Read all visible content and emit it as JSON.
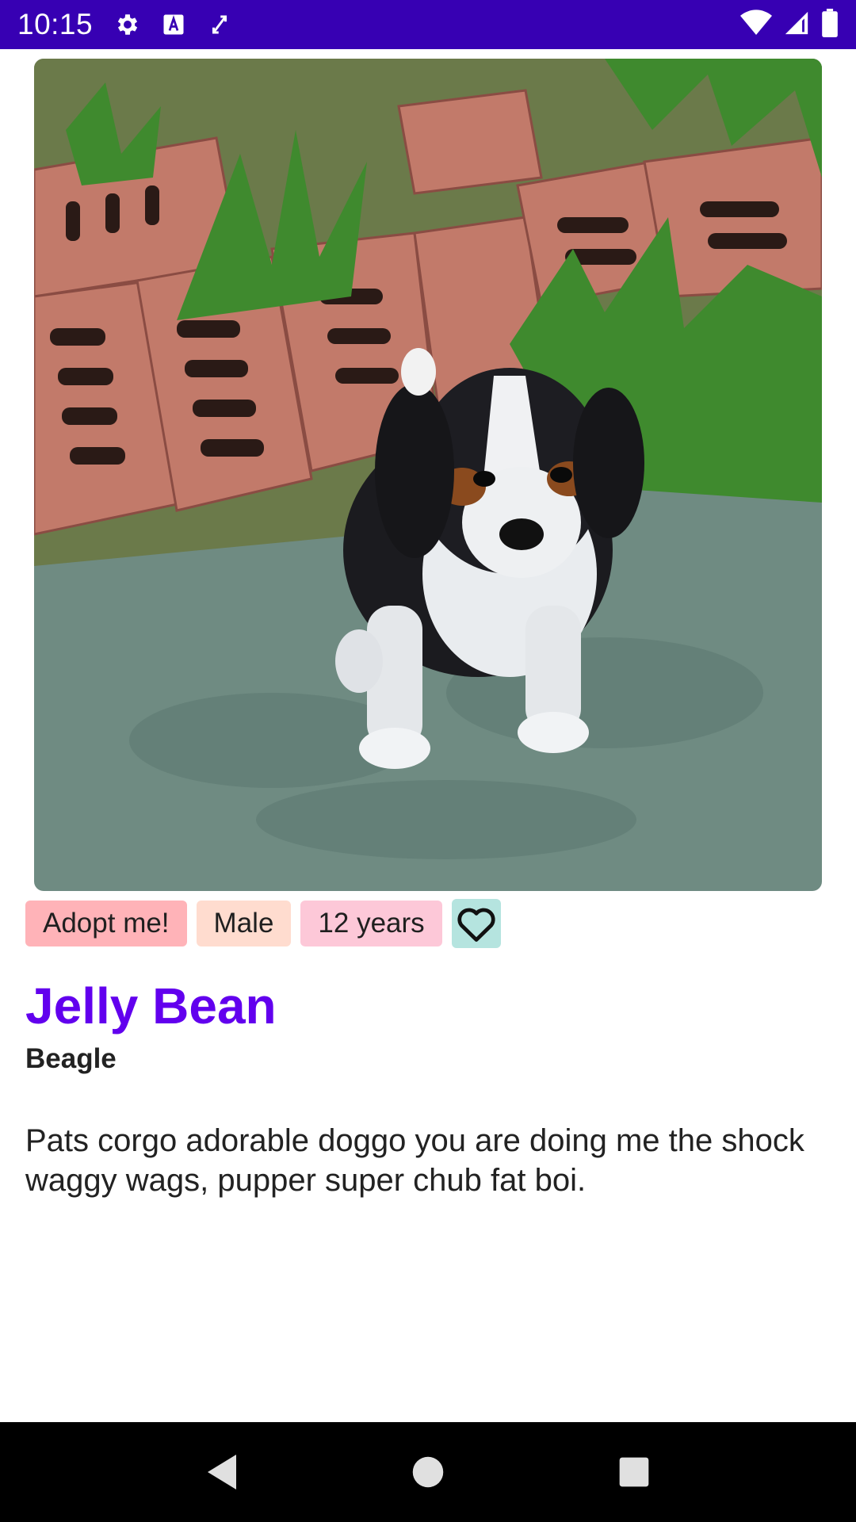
{
  "status_bar": {
    "time": "10:15",
    "icons": [
      "settings-icon",
      "text-a-icon",
      "shuffle-icon",
      "wifi-icon",
      "signal-icon",
      "battery-icon"
    ],
    "background": "#3700b3"
  },
  "pet": {
    "photo_subject": "puppy",
    "status_chip": "Adopt me!",
    "gender_chip": "Male",
    "age_chip": "12 years",
    "favorite_icon": "heart-outline-icon",
    "name": "Jelly Bean",
    "breed": "Beagle",
    "description": "Pats corgo adorable doggo you are doing me the shock waggy wags, pupper super chub fat boi."
  },
  "colors": {
    "accent": "#6200ee",
    "status_chip": "#ffb3b8",
    "gender_chip": "#ffdccf",
    "age_chip": "#fdc8d8",
    "favorite_button": "#b5e4df"
  },
  "nav_bar": {
    "icons": [
      "back-icon",
      "home-icon",
      "recents-icon"
    ]
  }
}
